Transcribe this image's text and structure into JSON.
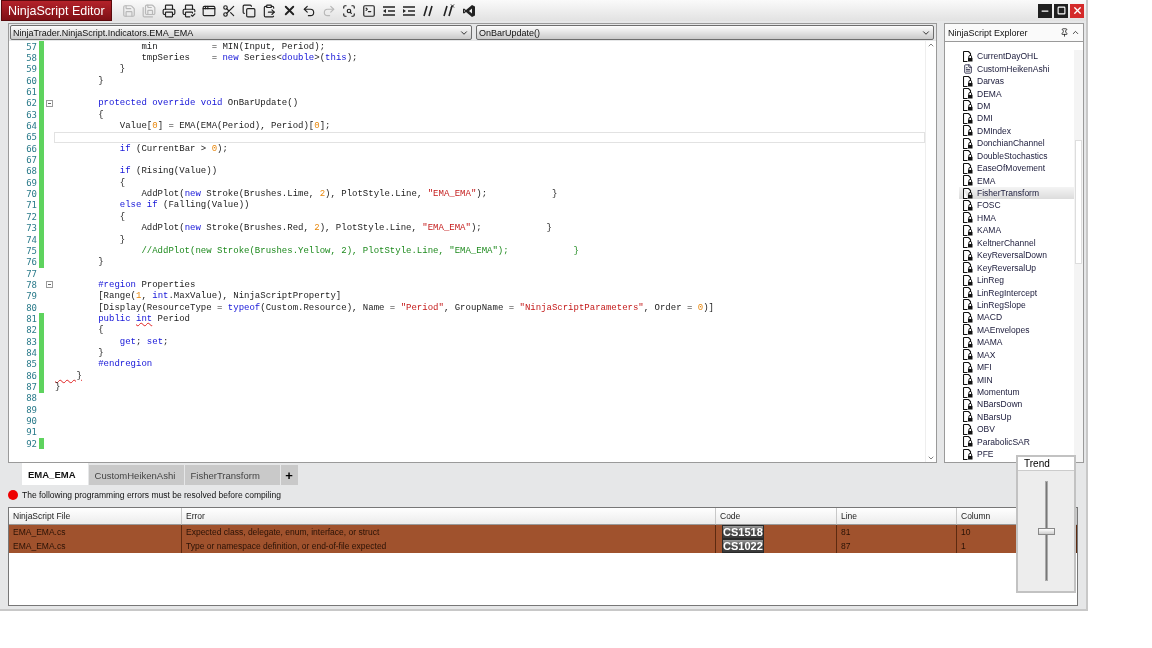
{
  "window": {
    "title": "NinjaScript Editor"
  },
  "toolbar": [
    {
      "kind": "save",
      "disabled": true
    },
    {
      "kind": "save-all",
      "disabled": true
    },
    {
      "kind": "print",
      "disabled": false
    },
    {
      "kind": "print-preview",
      "disabled": false
    },
    {
      "kind": "page-setup",
      "disabled": false
    },
    {
      "kind": "cut",
      "disabled": false
    },
    {
      "kind": "copy",
      "disabled": false
    },
    {
      "kind": "paste",
      "disabled": false
    },
    {
      "kind": "delete",
      "disabled": false
    },
    {
      "kind": "undo",
      "disabled": false
    },
    {
      "kind": "redo",
      "disabled": true
    },
    {
      "kind": "find",
      "disabled": false
    },
    {
      "kind": "compile",
      "disabled": false
    },
    {
      "kind": "outdent",
      "disabled": false
    },
    {
      "kind": "indent",
      "disabled": false
    },
    {
      "kind": "comment",
      "disabled": false
    },
    {
      "kind": "uncomment",
      "disabled": false
    },
    {
      "kind": "visual-studio",
      "disabled": false
    }
  ],
  "editor": {
    "class_selector": "NinjaTrader.NinjaScript.Indicators.EMA_EMA",
    "member_selector": "OnBarUpdate()",
    "lines": [
      {
        "n": "57",
        "changed": true,
        "fold": false,
        "current": false,
        "code": [
          {
            "kind": "plain",
            "s": "                min          = MIN(Input, Period);"
          }
        ]
      },
      {
        "n": "58",
        "changed": true,
        "fold": false,
        "current": false,
        "code": [
          {
            "kind": "plain",
            "s": "                tmpSeries    = "
          },
          {
            "kind": "keyword",
            "s": "new"
          },
          {
            "kind": "plain",
            "s": " Series<"
          },
          {
            "kind": "keyword",
            "s": "double"
          },
          {
            "kind": "plain",
            "s": ">("
          },
          {
            "kind": "keyword",
            "s": "this"
          },
          {
            "kind": "plain",
            "s": ");"
          }
        ]
      },
      {
        "n": "59",
        "changed": true,
        "fold": false,
        "current": false,
        "code": [
          {
            "kind": "plain",
            "s": "            }"
          }
        ]
      },
      {
        "n": "60",
        "changed": true,
        "fold": false,
        "current": false,
        "code": [
          {
            "kind": "plain",
            "s": "        }"
          }
        ]
      },
      {
        "n": "61",
        "changed": true,
        "fold": false,
        "current": false
      },
      {
        "n": "62",
        "changed": true,
        "fold": true,
        "current": false,
        "code": [
          {
            "kind": "keyword",
            "s": "        protected override void"
          },
          {
            "kind": "plain",
            "s": " OnBarUpdate()"
          }
        ]
      },
      {
        "n": "63",
        "changed": true,
        "fold": false,
        "current": false,
        "code": [
          {
            "kind": "plain",
            "s": "        {"
          }
        ]
      },
      {
        "n": "64",
        "changed": true,
        "fold": false,
        "current": false,
        "code": [
          {
            "kind": "plain",
            "s": "            Value["
          },
          {
            "kind": "number",
            "s": "0"
          },
          {
            "kind": "plain",
            "s": "] = EMA(EMA(Period), Period)["
          },
          {
            "kind": "number",
            "s": "0"
          },
          {
            "kind": "plain",
            "s": "];"
          }
        ]
      },
      {
        "n": "65",
        "changed": true,
        "fold": false,
        "current": true
      },
      {
        "n": "66",
        "changed": true,
        "fold": false,
        "current": false,
        "code": [
          {
            "kind": "keyword",
            "s": "            if"
          },
          {
            "kind": "plain",
            "s": " (CurrentBar > "
          },
          {
            "kind": "number",
            "s": "0"
          },
          {
            "kind": "plain",
            "s": ");"
          }
        ]
      },
      {
        "n": "67",
        "changed": true,
        "fold": false,
        "current": false
      },
      {
        "n": "68",
        "changed": true,
        "fold": false,
        "current": false,
        "code": [
          {
            "kind": "keyword",
            "s": "            if"
          },
          {
            "kind": "plain",
            "s": " (Rising(Value))"
          }
        ]
      },
      {
        "n": "69",
        "changed": true,
        "fold": false,
        "current": false,
        "code": [
          {
            "kind": "plain",
            "s": "            {"
          }
        ]
      },
      {
        "n": "70",
        "changed": true,
        "fold": false,
        "current": false,
        "code": [
          {
            "kind": "plain",
            "s": "                AddPlot("
          },
          {
            "kind": "keyword",
            "s": "new"
          },
          {
            "kind": "plain",
            "s": " Stroke(Brushes.Lime, "
          },
          {
            "kind": "number",
            "s": "2"
          },
          {
            "kind": "plain",
            "s": "), PlotStyle.Line, "
          },
          {
            "kind": "string",
            "s": "\"EMA_EMA\""
          },
          {
            "kind": "plain",
            "s": ");            }"
          }
        ]
      },
      {
        "n": "71",
        "changed": true,
        "fold": false,
        "current": false,
        "code": [
          {
            "kind": "keyword",
            "s": "            else if"
          },
          {
            "kind": "plain",
            "s": " (Falling(Value))"
          }
        ]
      },
      {
        "n": "72",
        "changed": true,
        "fold": false,
        "current": false,
        "code": [
          {
            "kind": "plain",
            "s": "            {"
          }
        ]
      },
      {
        "n": "73",
        "changed": true,
        "fold": false,
        "current": false,
        "code": [
          {
            "kind": "plain",
            "s": "                AddPlot("
          },
          {
            "kind": "keyword",
            "s": "new"
          },
          {
            "kind": "plain",
            "s": " Stroke(Brushes.Red, "
          },
          {
            "kind": "number",
            "s": "2"
          },
          {
            "kind": "plain",
            "s": "), PlotStyle.Line, "
          },
          {
            "kind": "string",
            "s": "\"EMA_EMA\""
          },
          {
            "kind": "plain",
            "s": ");            }"
          }
        ]
      },
      {
        "n": "74",
        "changed": true,
        "fold": false,
        "current": false,
        "code": [
          {
            "kind": "plain",
            "s": "            }"
          }
        ]
      },
      {
        "n": "75",
        "changed": true,
        "fold": false,
        "current": false,
        "code": [
          {
            "kind": "comment",
            "s": "                //AddPlot(new Stroke(Brushes.Yellow, 2), PlotStyle.Line, \"EMA_EMA\");            }"
          }
        ]
      },
      {
        "n": "76",
        "changed": true,
        "fold": false,
        "current": false,
        "code": [
          {
            "kind": "plain",
            "s": "        }"
          }
        ]
      },
      {
        "n": "77",
        "changed": false,
        "fold": false,
        "current": false
      },
      {
        "n": "78",
        "changed": false,
        "fold": true,
        "current": false,
        "code": [
          {
            "kind": "keyword",
            "s": "        #region"
          },
          {
            "kind": "plain",
            "s": " Properties"
          }
        ]
      },
      {
        "n": "79",
        "changed": false,
        "fold": false,
        "current": false,
        "code": [
          {
            "kind": "plain",
            "s": "        [Range("
          },
          {
            "kind": "number",
            "s": "1"
          },
          {
            "kind": "plain",
            "s": ", "
          },
          {
            "kind": "keyword",
            "s": "int"
          },
          {
            "kind": "plain",
            "s": ".MaxValue), NinjaScriptProperty]"
          }
        ]
      },
      {
        "n": "80",
        "changed": false,
        "fold": false,
        "current": false,
        "code": [
          {
            "kind": "plain",
            "s": "        [Display(ResourceType = "
          },
          {
            "kind": "keyword",
            "s": "typeof"
          },
          {
            "kind": "plain",
            "s": "(Custom.Resource), Name = "
          },
          {
            "kind": "string",
            "s": "\"Period\""
          },
          {
            "kind": "plain",
            "s": ", GroupName = "
          },
          {
            "kind": "string",
            "s": "\"NinjaScriptParameters\""
          },
          {
            "kind": "plain",
            "s": ", Order = "
          },
          {
            "kind": "number",
            "s": "0"
          },
          {
            "kind": "plain",
            "s": ")]"
          }
        ]
      },
      {
        "n": "81",
        "changed": true,
        "fold": false,
        "current": false,
        "code": [
          {
            "kind": "keyword",
            "s": "        public "
          },
          {
            "kind": "keyword",
            "s": "int",
            "squiggle": true
          },
          {
            "kind": "plain",
            "s": " Period"
          }
        ]
      },
      {
        "n": "82",
        "changed": true,
        "fold": false,
        "current": false,
        "code": [
          {
            "kind": "plain",
            "s": "        {"
          }
        ]
      },
      {
        "n": "83",
        "changed": true,
        "fold": false,
        "current": false,
        "code": [
          {
            "kind": "keyword",
            "s": "            get"
          },
          {
            "kind": "plain",
            "s": "; "
          },
          {
            "kind": "keyword",
            "s": "set"
          },
          {
            "kind": "plain",
            "s": ";"
          }
        ]
      },
      {
        "n": "84",
        "changed": true,
        "fold": false,
        "current": false,
        "code": [
          {
            "kind": "plain",
            "s": "        }"
          }
        ]
      },
      {
        "n": "85",
        "changed": true,
        "fold": false,
        "current": false,
        "code": [
          {
            "kind": "keyword",
            "s": "        #endregion"
          }
        ]
      },
      {
        "n": "86",
        "changed": true,
        "fold": false,
        "current": false,
        "code": [
          {
            "kind": "plain",
            "s": "    }",
            "squiggle": true
          }
        ]
      },
      {
        "n": "87",
        "changed": true,
        "fold": false,
        "current": false,
        "code": [
          {
            "kind": "plain",
            "s": "}"
          }
        ]
      },
      {
        "n": "88",
        "changed": false,
        "fold": false,
        "current": false
      },
      {
        "n": "89",
        "changed": false,
        "fold": false,
        "current": false
      },
      {
        "n": "90",
        "changed": false,
        "fold": false,
        "current": false
      },
      {
        "n": "91",
        "changed": false,
        "fold": false,
        "current": false
      },
      {
        "n": "92",
        "changed": true,
        "fold": false,
        "current": false
      }
    ]
  },
  "explorer": {
    "title": "NinjaScript Explorer",
    "items": [
      {
        "label": "CurrentDayOHL",
        "kind": "locked",
        "selected": false
      },
      {
        "label": "CustomHeikenAshi",
        "kind": "editable",
        "selected": false
      },
      {
        "label": "Darvas",
        "kind": "locked",
        "selected": false
      },
      {
        "label": "DEMA",
        "kind": "locked",
        "selected": false
      },
      {
        "label": "DM",
        "kind": "locked",
        "selected": false
      },
      {
        "label": "DMI",
        "kind": "locked",
        "selected": false
      },
      {
        "label": "DMIndex",
        "kind": "locked",
        "selected": false
      },
      {
        "label": "DonchianChannel",
        "kind": "locked",
        "selected": false
      },
      {
        "label": "DoubleStochastics",
        "kind": "locked",
        "selected": false
      },
      {
        "label": "EaseOfMovement",
        "kind": "locked",
        "selected": false
      },
      {
        "label": "EMA",
        "kind": "locked",
        "selected": false
      },
      {
        "label": "FisherTransform",
        "kind": "locked",
        "selected": true
      },
      {
        "label": "FOSC",
        "kind": "locked",
        "selected": false
      },
      {
        "label": "HMA",
        "kind": "locked",
        "selected": false
      },
      {
        "label": "KAMA",
        "kind": "locked",
        "selected": false
      },
      {
        "label": "KeltnerChannel",
        "kind": "locked",
        "selected": false
      },
      {
        "label": "KeyReversalDown",
        "kind": "locked",
        "selected": false
      },
      {
        "label": "KeyReversalUp",
        "kind": "locked",
        "selected": false
      },
      {
        "label": "LinReg",
        "kind": "locked",
        "selected": false
      },
      {
        "label": "LinRegIntercept",
        "kind": "locked",
        "selected": false
      },
      {
        "label": "LinRegSlope",
        "kind": "locked",
        "selected": false
      },
      {
        "label": "MACD",
        "kind": "locked",
        "selected": false
      },
      {
        "label": "MAEnvelopes",
        "kind": "locked",
        "selected": false
      },
      {
        "label": "MAMA",
        "kind": "locked",
        "selected": false
      },
      {
        "label": "MAX",
        "kind": "locked",
        "selected": false
      },
      {
        "label": "MFI",
        "kind": "locked",
        "selected": false
      },
      {
        "label": "MIN",
        "kind": "locked",
        "selected": false
      },
      {
        "label": "Momentum",
        "kind": "locked",
        "selected": false
      },
      {
        "label": "NBarsDown",
        "kind": "locked",
        "selected": false
      },
      {
        "label": "NBarsUp",
        "kind": "locked",
        "selected": false
      },
      {
        "label": "OBV",
        "kind": "locked",
        "selected": false
      },
      {
        "label": "ParabolicSAR",
        "kind": "locked",
        "selected": false
      },
      {
        "label": "PFE",
        "kind": "locked",
        "selected": false
      }
    ]
  },
  "tabs": [
    {
      "label": "EMA_EMA",
      "selected": true
    },
    {
      "label": "CustomHeikenAshi",
      "selected": false
    },
    {
      "label": "FisherTransform",
      "selected": false
    }
  ],
  "add_tab": "+",
  "message": "The following programming errors must be resolved before compiling",
  "errors": {
    "columns": [
      "NinjaScript File",
      "Error",
      "Code",
      "Line",
      "Column"
    ],
    "rows": [
      {
        "file": "EMA_EMA.cs",
        "error": "Expected class, delegate, enum, interface, or struct",
        "code": "CS1518",
        "line": "81",
        "column": "10"
      },
      {
        "file": "EMA_EMA.cs",
        "error": "Type or namespace definition, or end-of-file expected",
        "code": "CS1022",
        "line": "87",
        "column": "1"
      }
    ]
  },
  "trend_panel": {
    "title": "Trend",
    "level": 0.5
  }
}
